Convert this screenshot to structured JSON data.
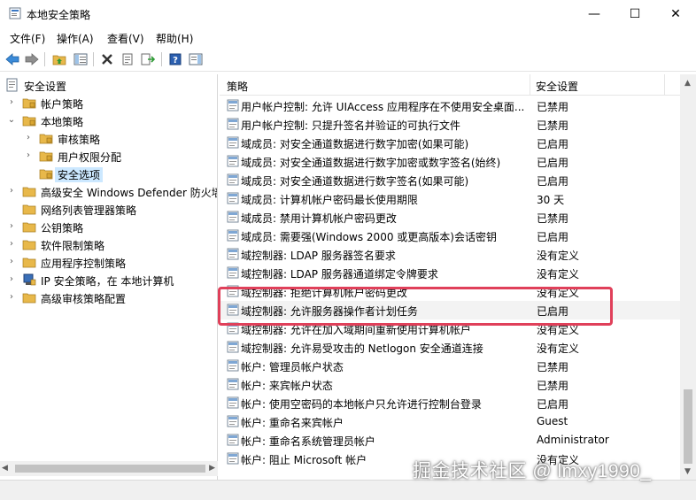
{
  "window": {
    "title": "本地安全策略",
    "buttons": {
      "minimize": "—",
      "maximize": "☐",
      "close": "✕"
    }
  },
  "menubar": [
    {
      "label": "文件(F)"
    },
    {
      "label": "操作(A)"
    },
    {
      "label": "查看(V)"
    },
    {
      "label": "帮助(H)"
    }
  ],
  "toolbar": [
    {
      "icon": "back-arrow-icon"
    },
    {
      "icon": "forward-arrow-icon"
    },
    {
      "icon": "up-folder-icon"
    },
    {
      "icon": "show-hide-tree-icon"
    },
    {
      "icon": "delete-icon"
    },
    {
      "icon": "properties-icon"
    },
    {
      "icon": "export-list-icon"
    },
    {
      "icon": "help-icon"
    },
    {
      "icon": "show-action-pane-icon"
    }
  ],
  "tree": [
    {
      "label": "安全设置",
      "level": 0,
      "chevron": "",
      "icon": "security-settings-icon"
    },
    {
      "label": "帐户策略",
      "level": 1,
      "chevron": "›",
      "icon": "folder-icon"
    },
    {
      "label": "本地策略",
      "level": 1,
      "chevron": "⌄",
      "icon": "folder-icon"
    },
    {
      "label": "审核策略",
      "level": 2,
      "chevron": "›",
      "icon": "folder-icon"
    },
    {
      "label": "用户权限分配",
      "level": 2,
      "chevron": "›",
      "icon": "folder-icon"
    },
    {
      "label": "安全选项",
      "level": 2,
      "chevron": "",
      "icon": "folder-icon",
      "selected": true
    },
    {
      "label": "高级安全 Windows Defender 防火墙",
      "level": 1,
      "chevron": "›",
      "icon": "folder-icon"
    },
    {
      "label": "网络列表管理器策略",
      "level": 1,
      "chevron": "",
      "icon": "folder-icon"
    },
    {
      "label": "公钥策略",
      "level": 1,
      "chevron": "›",
      "icon": "folder-icon"
    },
    {
      "label": "软件限制策略",
      "level": 1,
      "chevron": "›",
      "icon": "folder-icon"
    },
    {
      "label": "应用程序控制策略",
      "level": 1,
      "chevron": "›",
      "icon": "folder-icon"
    },
    {
      "label": "IP 安全策略，在 本地计算机",
      "level": 1,
      "chevron": "›",
      "icon": "ip-security-icon"
    },
    {
      "label": "高级审核策略配置",
      "level": 1,
      "chevron": "›",
      "icon": "folder-icon"
    }
  ],
  "columns": {
    "policy": "策略",
    "setting": "安全设置"
  },
  "policies": [
    {
      "name": "用户帐户控制: 允许 UIAccess 应用程序在不使用安全桌面...",
      "setting": "已禁用"
    },
    {
      "name": "用户帐户控制: 只提升签名并验证的可执行文件",
      "setting": "已禁用"
    },
    {
      "name": "域成员: 对安全通道数据进行数字加密(如果可能)",
      "setting": "已启用"
    },
    {
      "name": "域成员: 对安全通道数据进行数字加密或数字签名(始终)",
      "setting": "已启用"
    },
    {
      "name": "域成员: 对安全通道数据进行数字签名(如果可能)",
      "setting": "已启用"
    },
    {
      "name": "域成员: 计算机帐户密码最长使用期限",
      "setting": "30 天"
    },
    {
      "name": "域成员: 禁用计算机帐户密码更改",
      "setting": "已禁用"
    },
    {
      "name": "域成员: 需要强(Windows 2000 或更高版本)会话密钥",
      "setting": "已启用"
    },
    {
      "name": "域控制器: LDAP 服务器签名要求",
      "setting": "没有定义"
    },
    {
      "name": "域控制器: LDAP 服务器通道绑定令牌要求",
      "setting": "没有定义"
    },
    {
      "name": "域控制器: 拒绝计算机帐户密码更改",
      "setting": "没有定义"
    },
    {
      "name": "域控制器: 允许服务器操作者计划任务",
      "setting": "已启用",
      "highlight": true
    },
    {
      "name": "域控制器: 允许在加入域期间重新使用计算机帐户",
      "setting": "没有定义"
    },
    {
      "name": "域控制器: 允许易受攻击的 Netlogon 安全通道连接",
      "setting": "没有定义"
    },
    {
      "name": "帐户: 管理员帐户状态",
      "setting": "已禁用"
    },
    {
      "name": "帐户: 来宾帐户状态",
      "setting": "已禁用"
    },
    {
      "name": "帐户: 使用空密码的本地帐户只允许进行控制台登录",
      "setting": "已启用"
    },
    {
      "name": "帐户: 重命名来宾帐户",
      "setting": "Guest"
    },
    {
      "name": "帐户: 重命名系统管理员帐户",
      "setting": "Administrator"
    },
    {
      "name": "帐户: 阻止 Microsoft 帐户",
      "setting": "没有定义"
    }
  ],
  "watermark": "掘金技术社区 @ lmxy1990_",
  "colors": {
    "highlight_border": "#e0405a",
    "selected_bg": "#cce8ff",
    "folder": "#e8b84a"
  }
}
